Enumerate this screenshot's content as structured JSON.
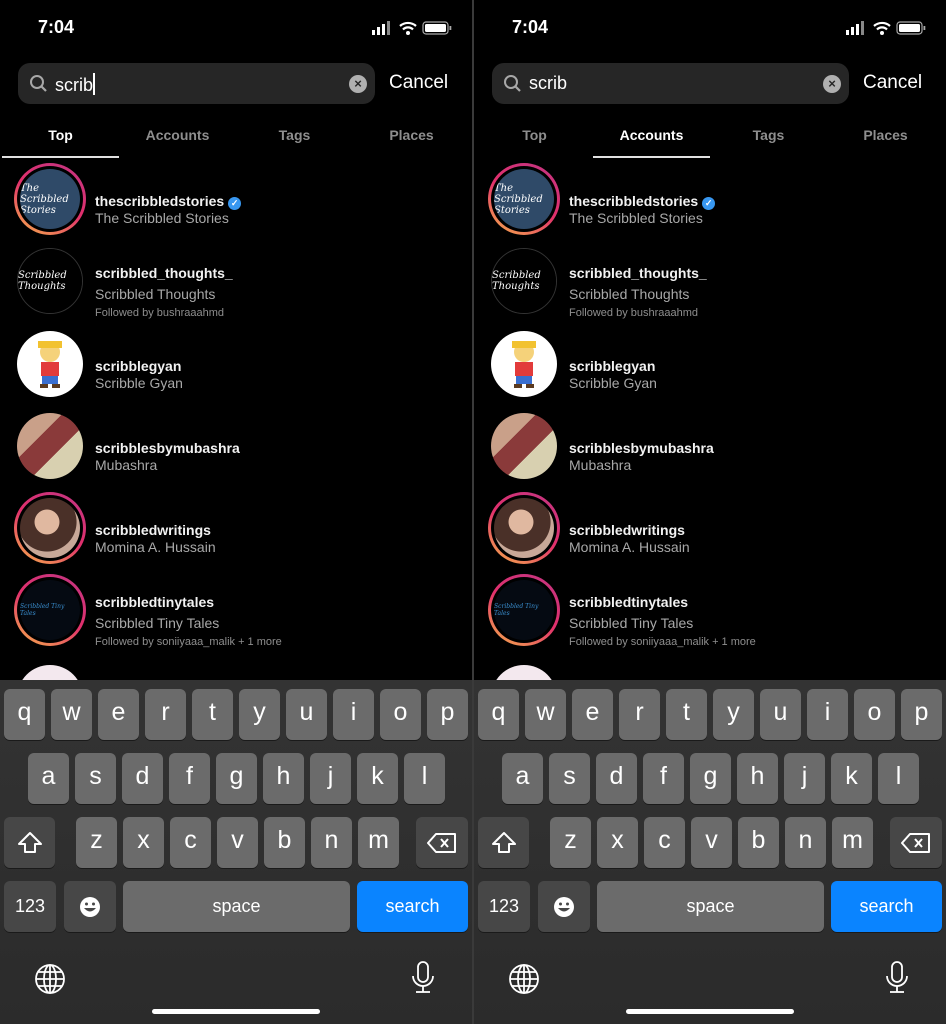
{
  "status": {
    "time": "7:04"
  },
  "search": {
    "query": "scrib",
    "cancel_label": "Cancel"
  },
  "tabs": [
    "Top",
    "Accounts",
    "Tags",
    "Places"
  ],
  "panels": [
    {
      "active_tab": "Top",
      "show_caret": true
    },
    {
      "active_tab": "Accounts",
      "show_caret": false
    }
  ],
  "results": [
    {
      "username": "thescribbledstories",
      "name": "The Scribbled Stories",
      "verified": true,
      "story_ring": true,
      "avatar_bg": "#2f4a68",
      "avatar_text": "The Scribbled Stories"
    },
    {
      "username": "scribbled_thoughts_",
      "name": "Scribbled Thoughts",
      "followed_by": "Followed by bushraaahmd",
      "story_ring": false,
      "avatar_bg": "#000000",
      "avatar_text": "Scribbled Thoughts"
    },
    {
      "username": "scribblegyan",
      "name": "Scribble Gyan",
      "story_ring": false,
      "avatar_bg": "#ffffff"
    },
    {
      "username": "scribblesbymubashra",
      "name": "Mubashra",
      "story_ring": false,
      "avatar_bg": "#8a4a44"
    },
    {
      "username": "scribbledwritings",
      "name": "Momina A. Hussain",
      "story_ring": true,
      "avatar_bg": "#a07868"
    },
    {
      "username": "scribbledtinytales",
      "name": "Scribbled Tiny Tales",
      "followed_by": "Followed by soniiyaaa_malik + 1 more",
      "story_ring": true,
      "avatar_bg": "#050a12",
      "avatar_text": "Scribbled Tiny Tales"
    }
  ],
  "keyboard": {
    "row1": [
      "q",
      "w",
      "e",
      "r",
      "t",
      "y",
      "u",
      "i",
      "o",
      "p"
    ],
    "row2": [
      "a",
      "s",
      "d",
      "f",
      "g",
      "h",
      "j",
      "k",
      "l"
    ],
    "row3": [
      "z",
      "x",
      "c",
      "v",
      "b",
      "n",
      "m"
    ],
    "numbers_label": "123",
    "space_label": "space",
    "search_label": "search"
  },
  "colors": {
    "accent": "#0a84ff",
    "verified": "#3897f0",
    "search_bg": "#262626"
  }
}
